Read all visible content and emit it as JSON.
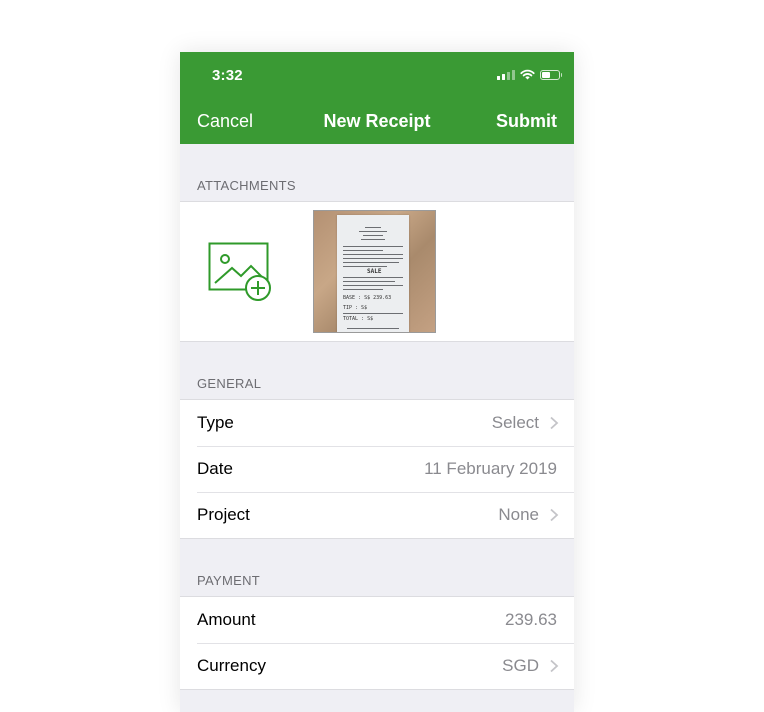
{
  "status_bar": {
    "time": "3:32",
    "icons": [
      "cellular-signal-icon",
      "wifi-icon",
      "battery-icon"
    ]
  },
  "nav_bar": {
    "cancel_label": "Cancel",
    "title": "New Receipt",
    "submit_label": "Submit",
    "background_color": "#3a9a34"
  },
  "sections": {
    "attachments": {
      "header": "ATTACHMENTS",
      "add_icon": "add-photo-icon",
      "thumbnail": {
        "receipt_lines": [
          "BASE : S$   239.63",
          "TIP  : S$",
          "TOTAL : S$"
        ],
        "sale_label": "SALE"
      }
    },
    "general": {
      "header": "GENERAL",
      "rows": [
        {
          "label": "Type",
          "value": "Select",
          "chevron": true
        },
        {
          "label": "Date",
          "value": "11 February 2019",
          "chevron": false
        },
        {
          "label": "Project",
          "value": "None",
          "chevron": true
        }
      ]
    },
    "payment": {
      "header": "PAYMENT",
      "rows": [
        {
          "label": "Amount",
          "value": "239.63",
          "chevron": false
        },
        {
          "label": "Currency",
          "value": "SGD",
          "chevron": true
        }
      ]
    }
  }
}
